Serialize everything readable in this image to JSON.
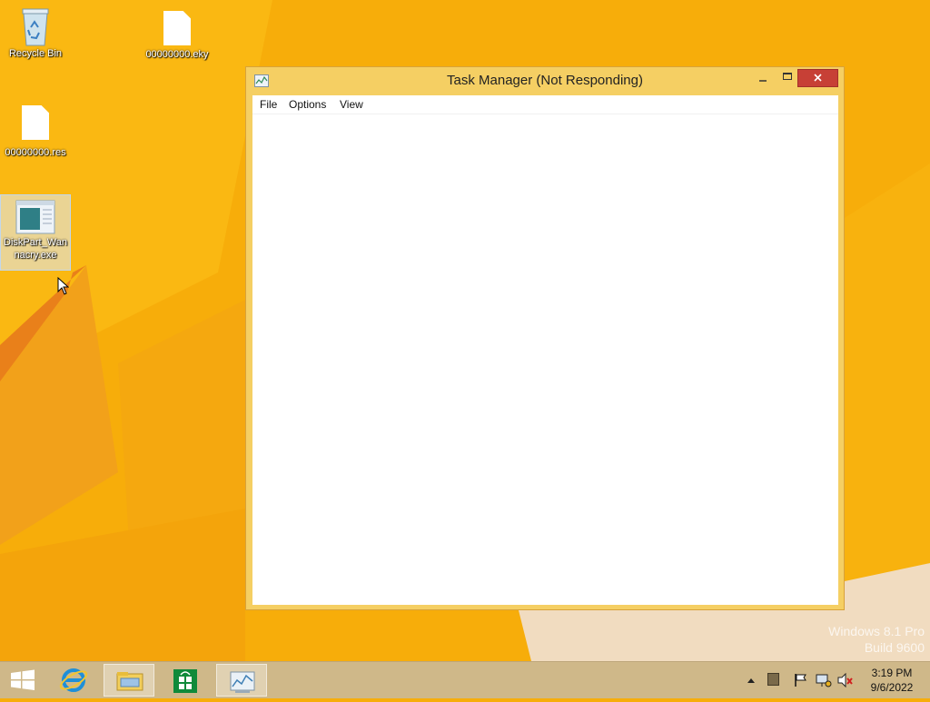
{
  "desktop": {
    "icons": [
      {
        "label": "Recycle Bin"
      },
      {
        "label": "00000000.eky"
      },
      {
        "label": "00000000.res"
      },
      {
        "label_line1": "DiskPart_Wan",
        "label_line2": "nacry.exe"
      }
    ]
  },
  "window": {
    "title": "Task Manager (Not Responding)",
    "menu": [
      "File",
      "Options",
      "View"
    ]
  },
  "watermark": {
    "line1": "Windows 8.1 Pro",
    "line2": "Build 9600"
  },
  "taskbar": {
    "apps": [
      "start-button",
      "internet-explorer",
      "file-explorer",
      "store",
      "task-manager"
    ],
    "clock_time": "3:19 PM",
    "clock_date": "9/6/2022"
  },
  "colors": {
    "wallpaper": "#f7ad0a",
    "window_frame": "#f5cf63",
    "close_button": "#c74036",
    "taskbar": "#cfb889"
  }
}
